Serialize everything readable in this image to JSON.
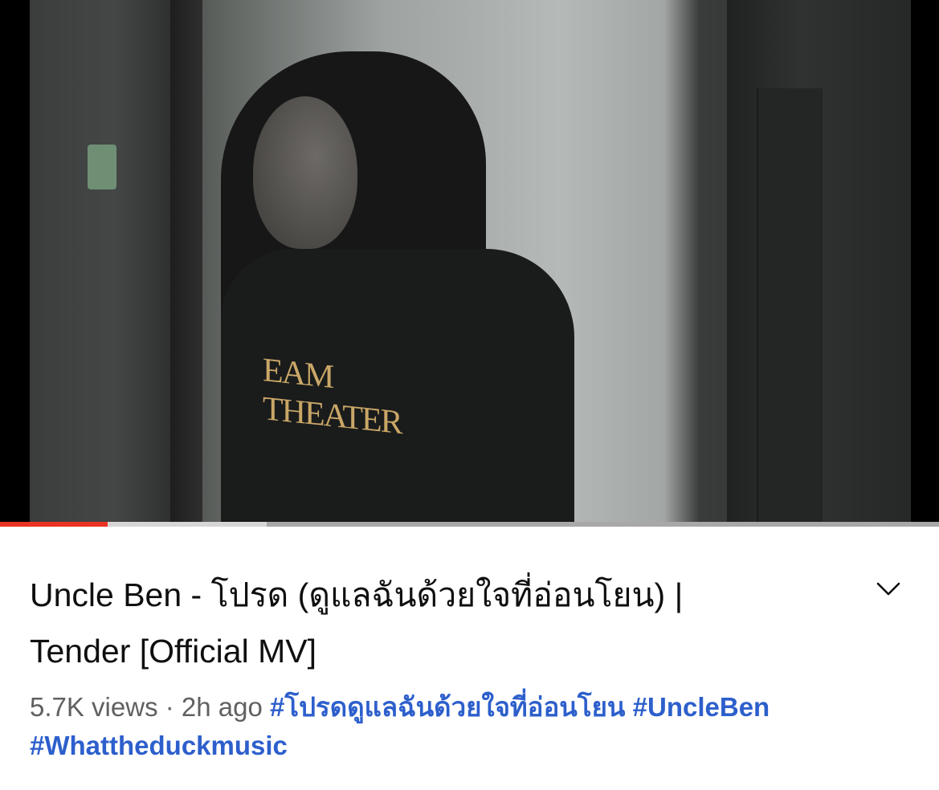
{
  "player": {
    "played_fraction": 0.115,
    "buffered_fraction": 0.284,
    "shirt_print": "EAM THEATER"
  },
  "video": {
    "title_line1": "Uncle Ben - โปรด (ดูแลฉันด้วยใจที่อ่อนโยน) |",
    "title_line2": "Tender [Official MV]",
    "views": "5.7K views",
    "separator": " · ",
    "time_ago": "2h ago",
    "hashtags": [
      "#โปรดดูแลฉันด้วยใจที่อ่อนโยน",
      "#UncleBen",
      "#Whattheduckmusic"
    ]
  },
  "icons": {
    "expand": "chevron-down-icon"
  },
  "colors": {
    "progress": "#ea3323",
    "hashtag": "#2d5fcc",
    "meta": "#606060"
  }
}
